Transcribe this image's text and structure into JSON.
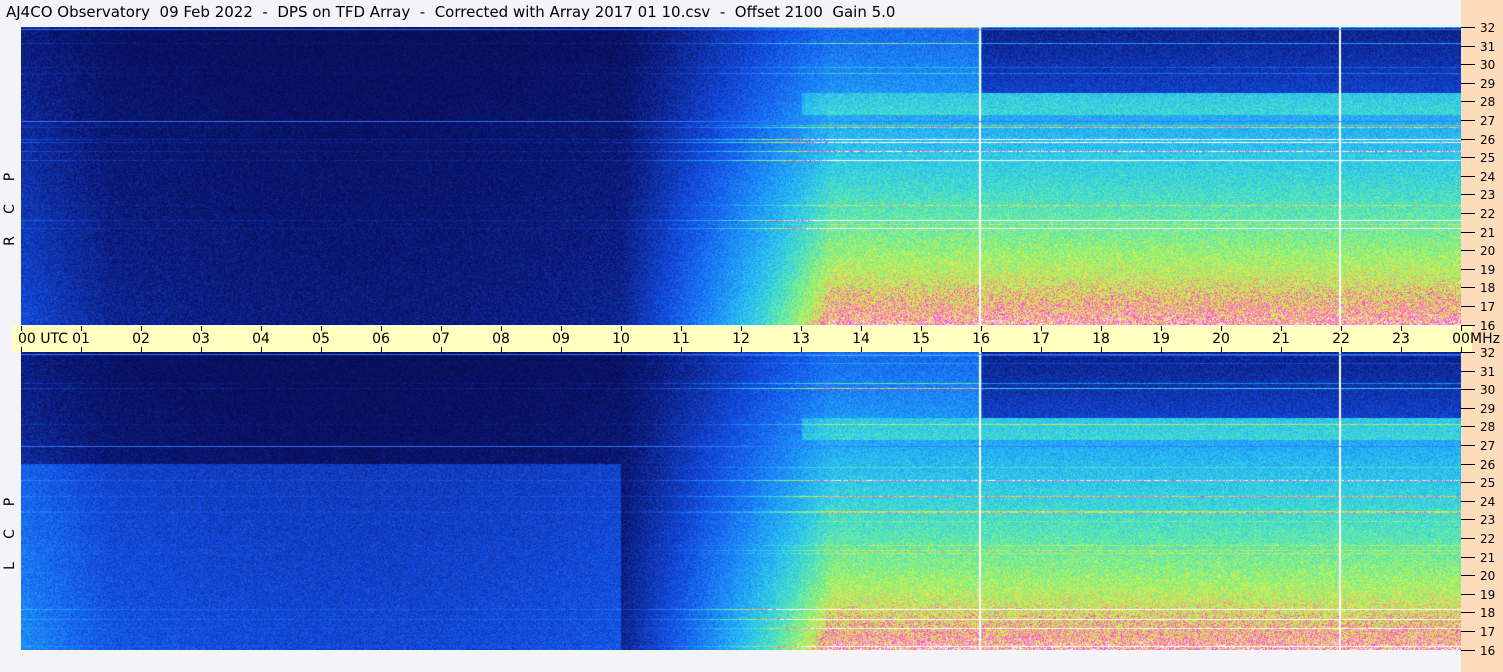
{
  "title": "AJ4CO Observatory  09 Feb 2022  -  DPS on TFD Array  -  Corrected with Array 2017 01 10.csv  -  Offset 2100  Gain 5.0",
  "time_axis": {
    "labels": [
      "00 UTC",
      "01",
      "02",
      "03",
      "04",
      "05",
      "06",
      "07",
      "08",
      "09",
      "10",
      "11",
      "12",
      "13",
      "14",
      "15",
      "16",
      "17",
      "18",
      "19",
      "20",
      "21",
      "22",
      "23",
      "00"
    ],
    "unit": "MHz"
  },
  "freq_axis": {
    "labels": [
      "32",
      "31",
      "30",
      "29",
      "28",
      "27",
      "26",
      "25",
      "24",
      "23",
      "22",
      "21",
      "20",
      "19",
      "18",
      "17",
      "16"
    ]
  },
  "panels": [
    {
      "label": "R C P",
      "letters": [
        "R",
        "C",
        "P"
      ]
    },
    {
      "label": "L C P",
      "letters": [
        "L",
        "C",
        "P"
      ]
    }
  ],
  "colors": {
    "axis_band": "#ffffc0",
    "right_band": "#fddcbc",
    "background": "#f4f4f8"
  }
}
